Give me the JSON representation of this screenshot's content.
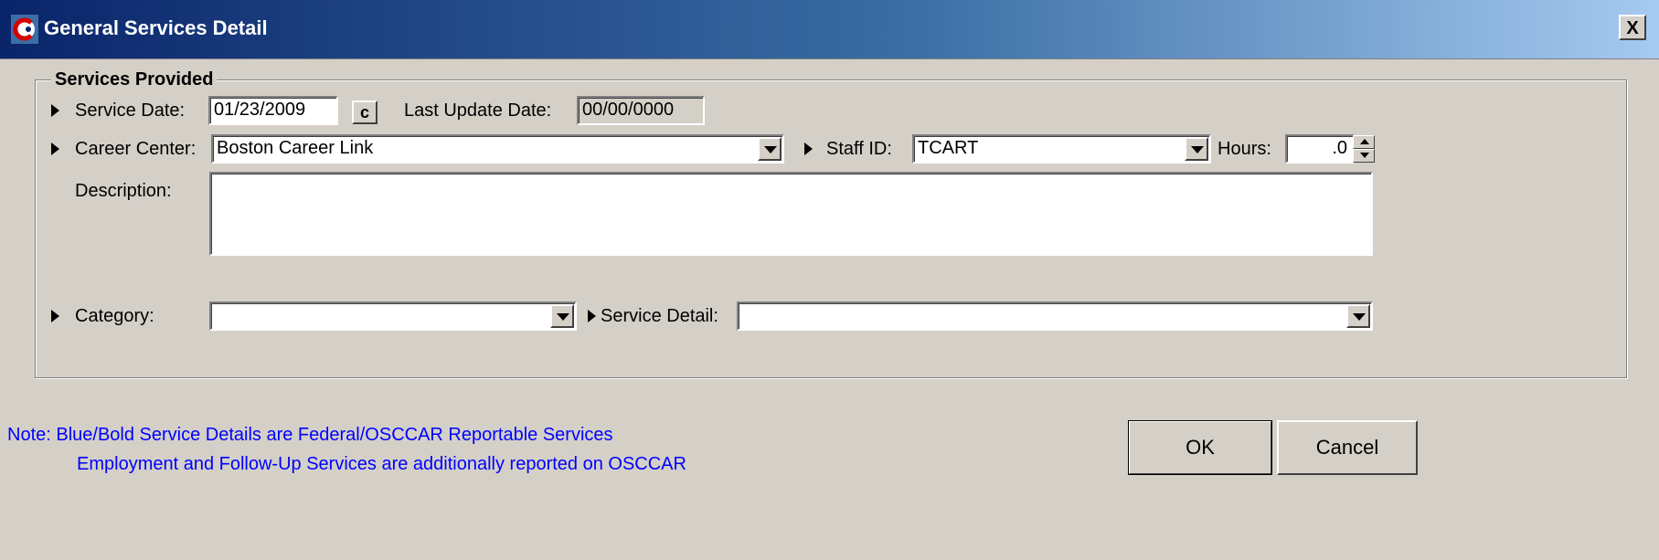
{
  "window": {
    "title": "General Services Detail",
    "close_label": "X"
  },
  "group": {
    "legend": "Services Provided"
  },
  "fields": {
    "service_date": {
      "label": "Service Date:",
      "value": "01/23/2009"
    },
    "calendar_button_label": "c",
    "last_update_date": {
      "label": "Last Update Date:",
      "value": "00/00/0000"
    },
    "career_center": {
      "label": "Career Center:",
      "value": "Boston Career Link"
    },
    "staff_id": {
      "label": "Staff ID:",
      "value": "TCART"
    },
    "hours": {
      "label": "Hours:",
      "value": ".0"
    },
    "description": {
      "label": "Description:",
      "value": ""
    },
    "category": {
      "label": "Category:",
      "value": ""
    },
    "service_detail": {
      "label": "Service Detail:",
      "value": ""
    }
  },
  "note": {
    "line1": "Note: Blue/Bold Service Details are Federal/OSCCAR Reportable Services",
    "line2": "Employment and Follow-Up Services are additionally reported on OSCCAR"
  },
  "buttons": {
    "ok": "OK",
    "cancel": "Cancel"
  },
  "colors": {
    "title_bar_start": "#0a246a",
    "title_bar_end": "#a6caf0",
    "note_text": "#0000ff",
    "window_face": "#d4d0c8"
  }
}
